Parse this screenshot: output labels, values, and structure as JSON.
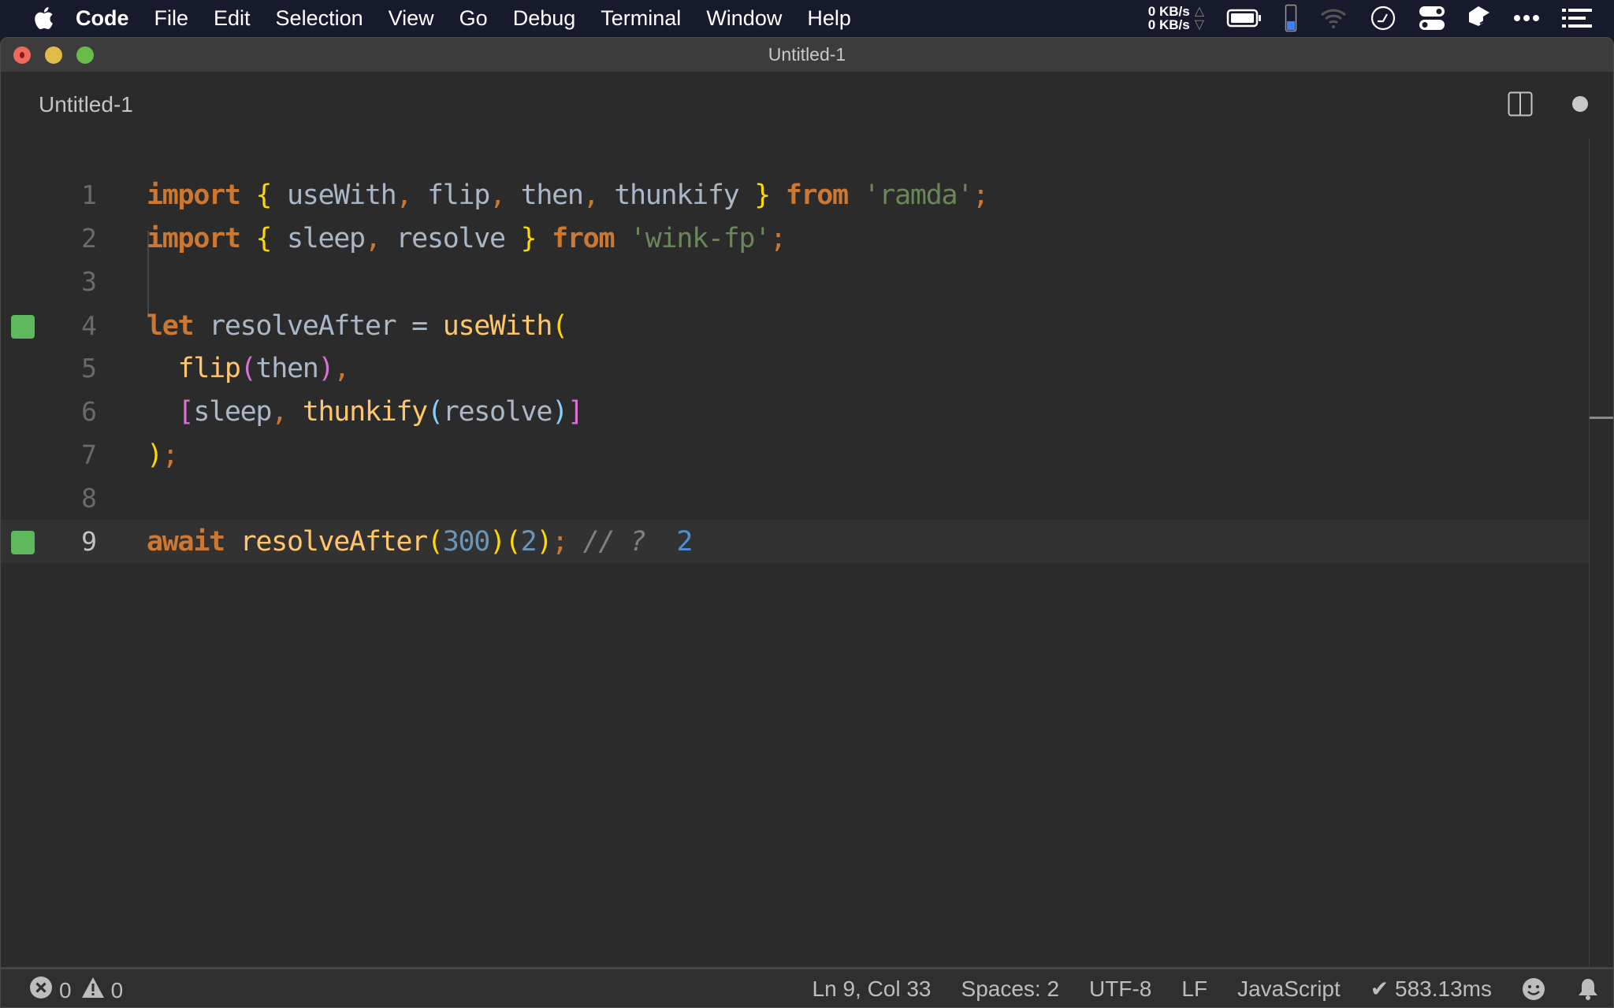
{
  "menubar": {
    "app_name": "Code",
    "items": [
      "File",
      "Edit",
      "Selection",
      "View",
      "Go",
      "Debug",
      "Terminal",
      "Window",
      "Help"
    ],
    "netspeed": {
      "up": "0 KB/s",
      "down": "0 KB/s"
    },
    "tray_icons": [
      "battery-icon",
      "phone-battery-icon",
      "wifi-icon",
      "clock-icon",
      "toggles-icon",
      "box-icon",
      "more-icon",
      "list-icon"
    ]
  },
  "window": {
    "title": "Untitled-1"
  },
  "tab": {
    "label": "Untitled-1",
    "dirty": true
  },
  "editor": {
    "current_line": 9,
    "lines": [
      {
        "n": "1",
        "marker": false
      },
      {
        "n": "2",
        "marker": false
      },
      {
        "n": "3",
        "marker": false
      },
      {
        "n": "4",
        "marker": true
      },
      {
        "n": "5",
        "marker": false
      },
      {
        "n": "6",
        "marker": false
      },
      {
        "n": "7",
        "marker": false
      },
      {
        "n": "8",
        "marker": false
      },
      {
        "n": "9",
        "marker": true
      }
    ],
    "tokens": {
      "l1": [
        "import",
        " ",
        "{",
        " useWith",
        ",",
        " flip",
        ",",
        " then",
        ",",
        " thunkify ",
        "}",
        " ",
        "from",
        " ",
        "'ramda'",
        ";"
      ],
      "l2": [
        "import",
        " ",
        "{",
        " sleep",
        ",",
        " resolve ",
        "}",
        " ",
        "from",
        " ",
        "'wink-fp'",
        ";"
      ],
      "l4": [
        "let",
        " resolveAfter = ",
        "useWith",
        "("
      ],
      "l5": [
        "  ",
        "flip",
        "(",
        "then",
        ")",
        ","
      ],
      "l6": [
        "  ",
        "[",
        "sleep",
        ",",
        " ",
        "thunkify",
        "(",
        "resolve",
        ")",
        "]"
      ],
      "l7": [
        ")",
        ";"
      ],
      "l9": [
        "await",
        " ",
        "resolveAfter",
        "(",
        "300",
        ")",
        "(",
        "2",
        ")",
        ";",
        " // ?  ",
        "2"
      ]
    },
    "quokka_result": "2"
  },
  "statusbar": {
    "errors": "0",
    "warnings": "0",
    "position": "Ln 9, Col 33",
    "spaces": "Spaces: 2",
    "encoding": "UTF-8",
    "eol": "LF",
    "language": "JavaScript",
    "timing": "✔ 583.13ms"
  },
  "colors": {
    "keyword": "#cc7832",
    "string": "#6a8759",
    "number": "#6897bb",
    "function": "#ffc66d",
    "identifier": "#a9b7c6",
    "bracket1": "#ffd700",
    "bracket2": "#da70d6",
    "bracket3": "#87cefa",
    "gutter_marker": "#5db95c"
  }
}
